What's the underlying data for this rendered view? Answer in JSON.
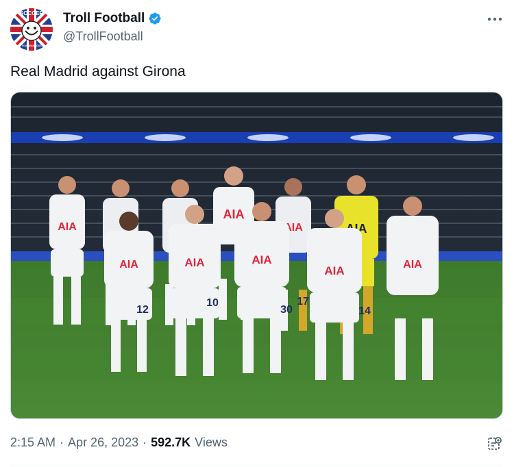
{
  "author": {
    "display_name": "Troll Football",
    "handle": "@TrollFootball",
    "avatar_text_top": "SOCCER",
    "avatar_text_bottom": "DON'T YOU MEAN FOOTBALL?",
    "verified": true
  },
  "tweet": {
    "text": "Real Madrid against Girona"
  },
  "media": {
    "description_icon": "team-photo",
    "shirt_sponsor": "AIA",
    "shirt_numbers": [
      "12",
      "10",
      "30",
      "17",
      "14"
    ]
  },
  "meta": {
    "time": "2:15 AM",
    "separator": "·",
    "date": "Apr 26, 2023",
    "views_count": "592.7K",
    "views_label": "Views"
  },
  "colors": {
    "accent_blue": "#1d9bf0",
    "text_primary": "#0f1419",
    "text_secondary": "#536471",
    "pitch_green": "#3f7f2f",
    "kit_white": "#f2f3f5",
    "keeper_yellow": "#e8e32a"
  }
}
